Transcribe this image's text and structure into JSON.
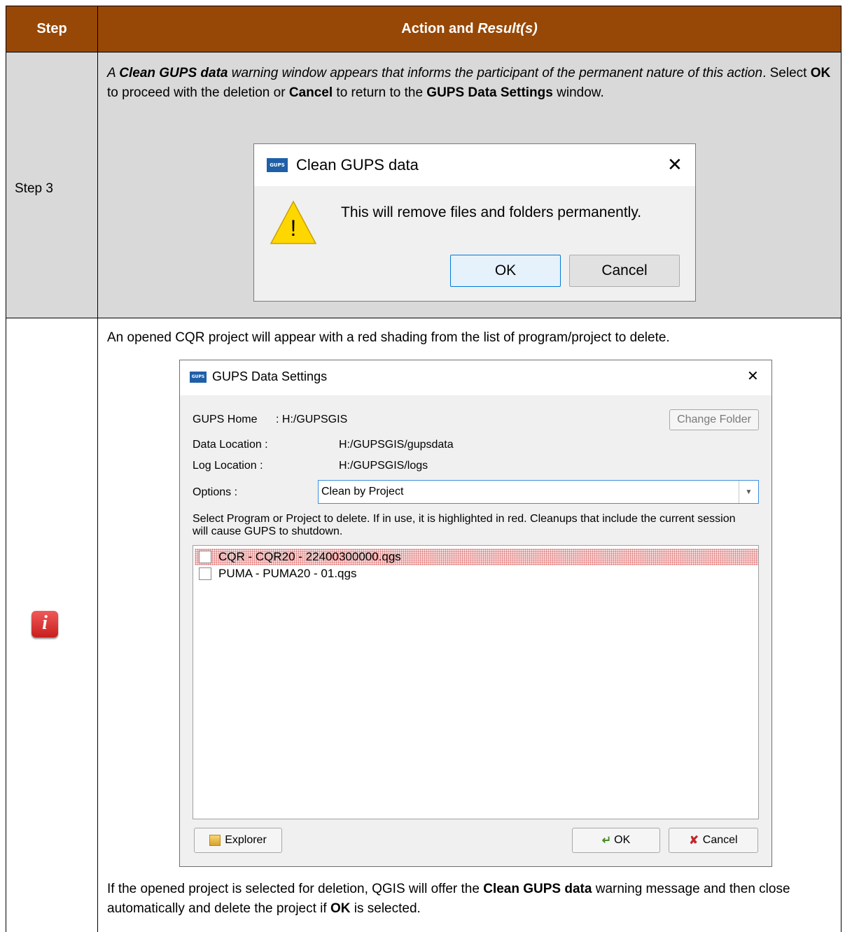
{
  "header": {
    "step": "Step",
    "action_prefix": "Action and ",
    "action_result": "Result(s)"
  },
  "row1": {
    "step_label": "Step 3",
    "p_intro_bold": "Clean GUPS data",
    "p_intro_start": "A ",
    "p_intro_end": " warning window appears that informs the participant of the permanent nature of this action",
    "p_select": ". Select ",
    "p_ok": "OK",
    "p_mid": " to proceed with the deletion or ",
    "p_cancel": "Cancel",
    "p_mid2": " to return to the ",
    "p_window": "GUPS Data Settings",
    "p_end": " window."
  },
  "clean_dialog": {
    "logo": "GUPS",
    "title": "Clean GUPS data",
    "message": "This will remove files and folders permanently.",
    "ok": "OK",
    "cancel": "Cancel",
    "warning_icon": "warning-icon",
    "warning_glyph": "!"
  },
  "row2": {
    "info_icon": "info-icon",
    "info_glyph": "i",
    "intro": "An opened CQR project will appear with a red shading from the list of program/project to delete.",
    "bottom_start": "If the opened project is selected for deletion, QGIS will offer the ",
    "bottom_bold": "Clean GUPS data",
    "bottom_mid": " warning message and then close automatically and delete the project if ",
    "bottom_ok": "OK",
    "bottom_end": " is selected."
  },
  "settings_dialog": {
    "logo": "GUPS",
    "title": "GUPS Data Settings",
    "home_label": "GUPS Home",
    "home_value": ": H:/GUPSGIS",
    "change_folder": "Change Folder",
    "data_label": "Data Location :",
    "data_value": "H:/GUPSGIS/gupsdata",
    "log_label": "Log Location :",
    "log_value": "H:/GUPSGIS/logs",
    "options_label": "Options :",
    "options_value": "Clean by Project",
    "instructions": "Select Program or Project to delete. If in use, it is highlighted in red. Cleanups that include the current session will cause GUPS to shutdown.",
    "items": [
      "CQR - CQR20 - 22400300000.qgs",
      "PUMA - PUMA20 - 01.qgs"
    ],
    "explorer": "Explorer",
    "ok": "OK",
    "cancel": "Cancel"
  },
  "colors": {
    "header_bg": "#974806",
    "gray_bg": "#d9d9d9",
    "gups_blue": "#1f5fa8",
    "highlight_red": "#f6dcdc"
  }
}
